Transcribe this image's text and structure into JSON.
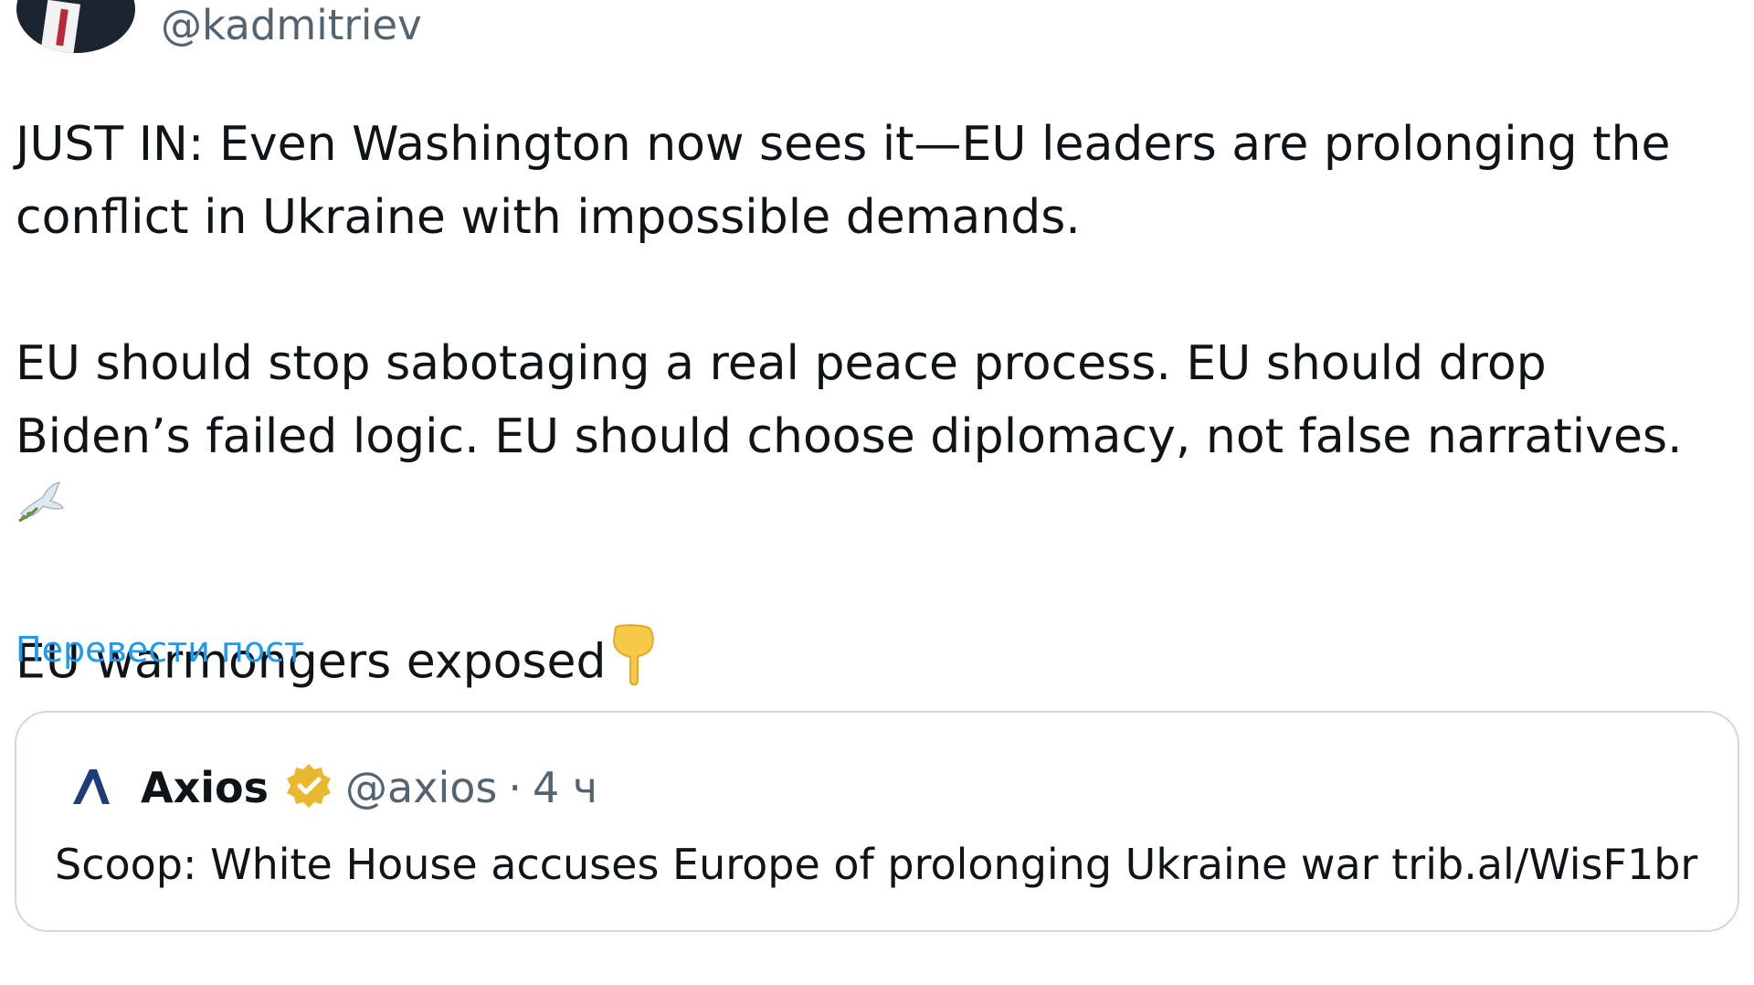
{
  "author": {
    "handle": "@kadmitriev"
  },
  "tweet": {
    "paragraph1": "JUST IN: Even Washington now sees it—EU leaders are prolonging the conflict in Ukraine with impossible demands.",
    "paragraph2": "EU should stop sabotaging a real peace process. EU should drop Biden’s failed logic. EU should choose diplomacy, not false narratives.",
    "paragraph3": "EU warmongers exposed",
    "translate_label": "Перевести пост"
  },
  "quoted_tweet": {
    "name": "Axios",
    "handle": "@axios",
    "separator": "·",
    "time": "4 ч",
    "text": "Scoop: White House accuses Europe of prolonging Ukraine war trib.al/WisF1br"
  },
  "icons": {
    "avatar": "avatar",
    "dove": "dove-icon",
    "pointing_down": "backhand-index-pointing-down-icon",
    "axios_logo": "axios-logo-icon",
    "verified_badge": "verified-badge-icon"
  },
  "colors": {
    "text_primary": "#0f1419",
    "text_secondary": "#536471",
    "link": "#1d9bf0",
    "border": "#cfd9de",
    "verified_gold": "#e8b92f",
    "axios_blue": "#1f3d7a"
  }
}
